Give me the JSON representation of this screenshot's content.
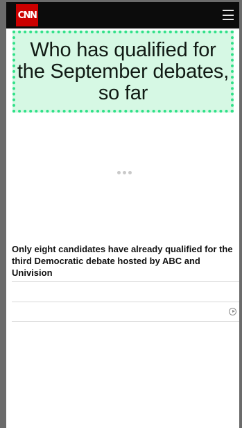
{
  "header": {
    "logo_text": "CNN",
    "menu_icon": "hamburger-menu-icon",
    "logo_color": "#cc0000"
  },
  "hero": {
    "title": "Who has qualified for the September debates, so far",
    "background_color": "#d6f8e4",
    "border_color": "#2fe188"
  },
  "loader": {
    "icon": "loading-dots-icon"
  },
  "article": {
    "description": "Only eight candidates have already qualified for the third Democratic debate hosted by ABC and Univision"
  },
  "media": {
    "play_icon": "play-circle-icon"
  }
}
